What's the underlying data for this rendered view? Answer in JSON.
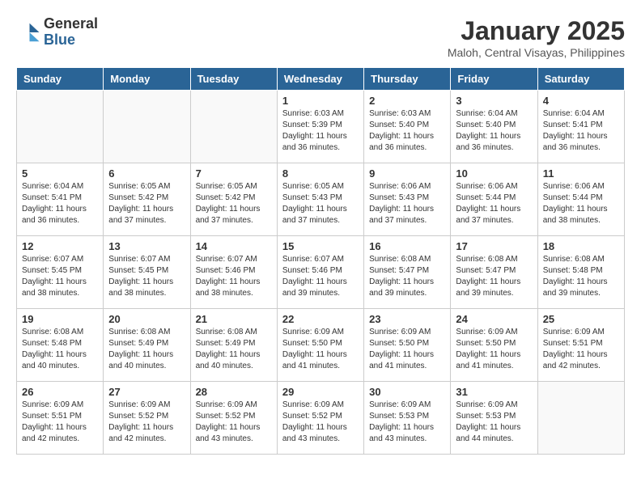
{
  "header": {
    "logo_general": "General",
    "logo_blue": "Blue",
    "title": "January 2025",
    "subtitle": "Maloh, Central Visayas, Philippines"
  },
  "weekdays": [
    "Sunday",
    "Monday",
    "Tuesday",
    "Wednesday",
    "Thursday",
    "Friday",
    "Saturday"
  ],
  "weeks": [
    [
      {
        "day": "",
        "info": ""
      },
      {
        "day": "",
        "info": ""
      },
      {
        "day": "",
        "info": ""
      },
      {
        "day": "1",
        "info": "Sunrise: 6:03 AM\nSunset: 5:39 PM\nDaylight: 11 hours\nand 36 minutes."
      },
      {
        "day": "2",
        "info": "Sunrise: 6:03 AM\nSunset: 5:40 PM\nDaylight: 11 hours\nand 36 minutes."
      },
      {
        "day": "3",
        "info": "Sunrise: 6:04 AM\nSunset: 5:40 PM\nDaylight: 11 hours\nand 36 minutes."
      },
      {
        "day": "4",
        "info": "Sunrise: 6:04 AM\nSunset: 5:41 PM\nDaylight: 11 hours\nand 36 minutes."
      }
    ],
    [
      {
        "day": "5",
        "info": "Sunrise: 6:04 AM\nSunset: 5:41 PM\nDaylight: 11 hours\nand 36 minutes."
      },
      {
        "day": "6",
        "info": "Sunrise: 6:05 AM\nSunset: 5:42 PM\nDaylight: 11 hours\nand 37 minutes."
      },
      {
        "day": "7",
        "info": "Sunrise: 6:05 AM\nSunset: 5:42 PM\nDaylight: 11 hours\nand 37 minutes."
      },
      {
        "day": "8",
        "info": "Sunrise: 6:05 AM\nSunset: 5:43 PM\nDaylight: 11 hours\nand 37 minutes."
      },
      {
        "day": "9",
        "info": "Sunrise: 6:06 AM\nSunset: 5:43 PM\nDaylight: 11 hours\nand 37 minutes."
      },
      {
        "day": "10",
        "info": "Sunrise: 6:06 AM\nSunset: 5:44 PM\nDaylight: 11 hours\nand 37 minutes."
      },
      {
        "day": "11",
        "info": "Sunrise: 6:06 AM\nSunset: 5:44 PM\nDaylight: 11 hours\nand 38 minutes."
      }
    ],
    [
      {
        "day": "12",
        "info": "Sunrise: 6:07 AM\nSunset: 5:45 PM\nDaylight: 11 hours\nand 38 minutes."
      },
      {
        "day": "13",
        "info": "Sunrise: 6:07 AM\nSunset: 5:45 PM\nDaylight: 11 hours\nand 38 minutes."
      },
      {
        "day": "14",
        "info": "Sunrise: 6:07 AM\nSunset: 5:46 PM\nDaylight: 11 hours\nand 38 minutes."
      },
      {
        "day": "15",
        "info": "Sunrise: 6:07 AM\nSunset: 5:46 PM\nDaylight: 11 hours\nand 39 minutes."
      },
      {
        "day": "16",
        "info": "Sunrise: 6:08 AM\nSunset: 5:47 PM\nDaylight: 11 hours\nand 39 minutes."
      },
      {
        "day": "17",
        "info": "Sunrise: 6:08 AM\nSunset: 5:47 PM\nDaylight: 11 hours\nand 39 minutes."
      },
      {
        "day": "18",
        "info": "Sunrise: 6:08 AM\nSunset: 5:48 PM\nDaylight: 11 hours\nand 39 minutes."
      }
    ],
    [
      {
        "day": "19",
        "info": "Sunrise: 6:08 AM\nSunset: 5:48 PM\nDaylight: 11 hours\nand 40 minutes."
      },
      {
        "day": "20",
        "info": "Sunrise: 6:08 AM\nSunset: 5:49 PM\nDaylight: 11 hours\nand 40 minutes."
      },
      {
        "day": "21",
        "info": "Sunrise: 6:08 AM\nSunset: 5:49 PM\nDaylight: 11 hours\nand 40 minutes."
      },
      {
        "day": "22",
        "info": "Sunrise: 6:09 AM\nSunset: 5:50 PM\nDaylight: 11 hours\nand 41 minutes."
      },
      {
        "day": "23",
        "info": "Sunrise: 6:09 AM\nSunset: 5:50 PM\nDaylight: 11 hours\nand 41 minutes."
      },
      {
        "day": "24",
        "info": "Sunrise: 6:09 AM\nSunset: 5:50 PM\nDaylight: 11 hours\nand 41 minutes."
      },
      {
        "day": "25",
        "info": "Sunrise: 6:09 AM\nSunset: 5:51 PM\nDaylight: 11 hours\nand 42 minutes."
      }
    ],
    [
      {
        "day": "26",
        "info": "Sunrise: 6:09 AM\nSunset: 5:51 PM\nDaylight: 11 hours\nand 42 minutes."
      },
      {
        "day": "27",
        "info": "Sunrise: 6:09 AM\nSunset: 5:52 PM\nDaylight: 11 hours\nand 42 minutes."
      },
      {
        "day": "28",
        "info": "Sunrise: 6:09 AM\nSunset: 5:52 PM\nDaylight: 11 hours\nand 43 minutes."
      },
      {
        "day": "29",
        "info": "Sunrise: 6:09 AM\nSunset: 5:52 PM\nDaylight: 11 hours\nand 43 minutes."
      },
      {
        "day": "30",
        "info": "Sunrise: 6:09 AM\nSunset: 5:53 PM\nDaylight: 11 hours\nand 43 minutes."
      },
      {
        "day": "31",
        "info": "Sunrise: 6:09 AM\nSunset: 5:53 PM\nDaylight: 11 hours\nand 44 minutes."
      },
      {
        "day": "",
        "info": ""
      }
    ]
  ]
}
